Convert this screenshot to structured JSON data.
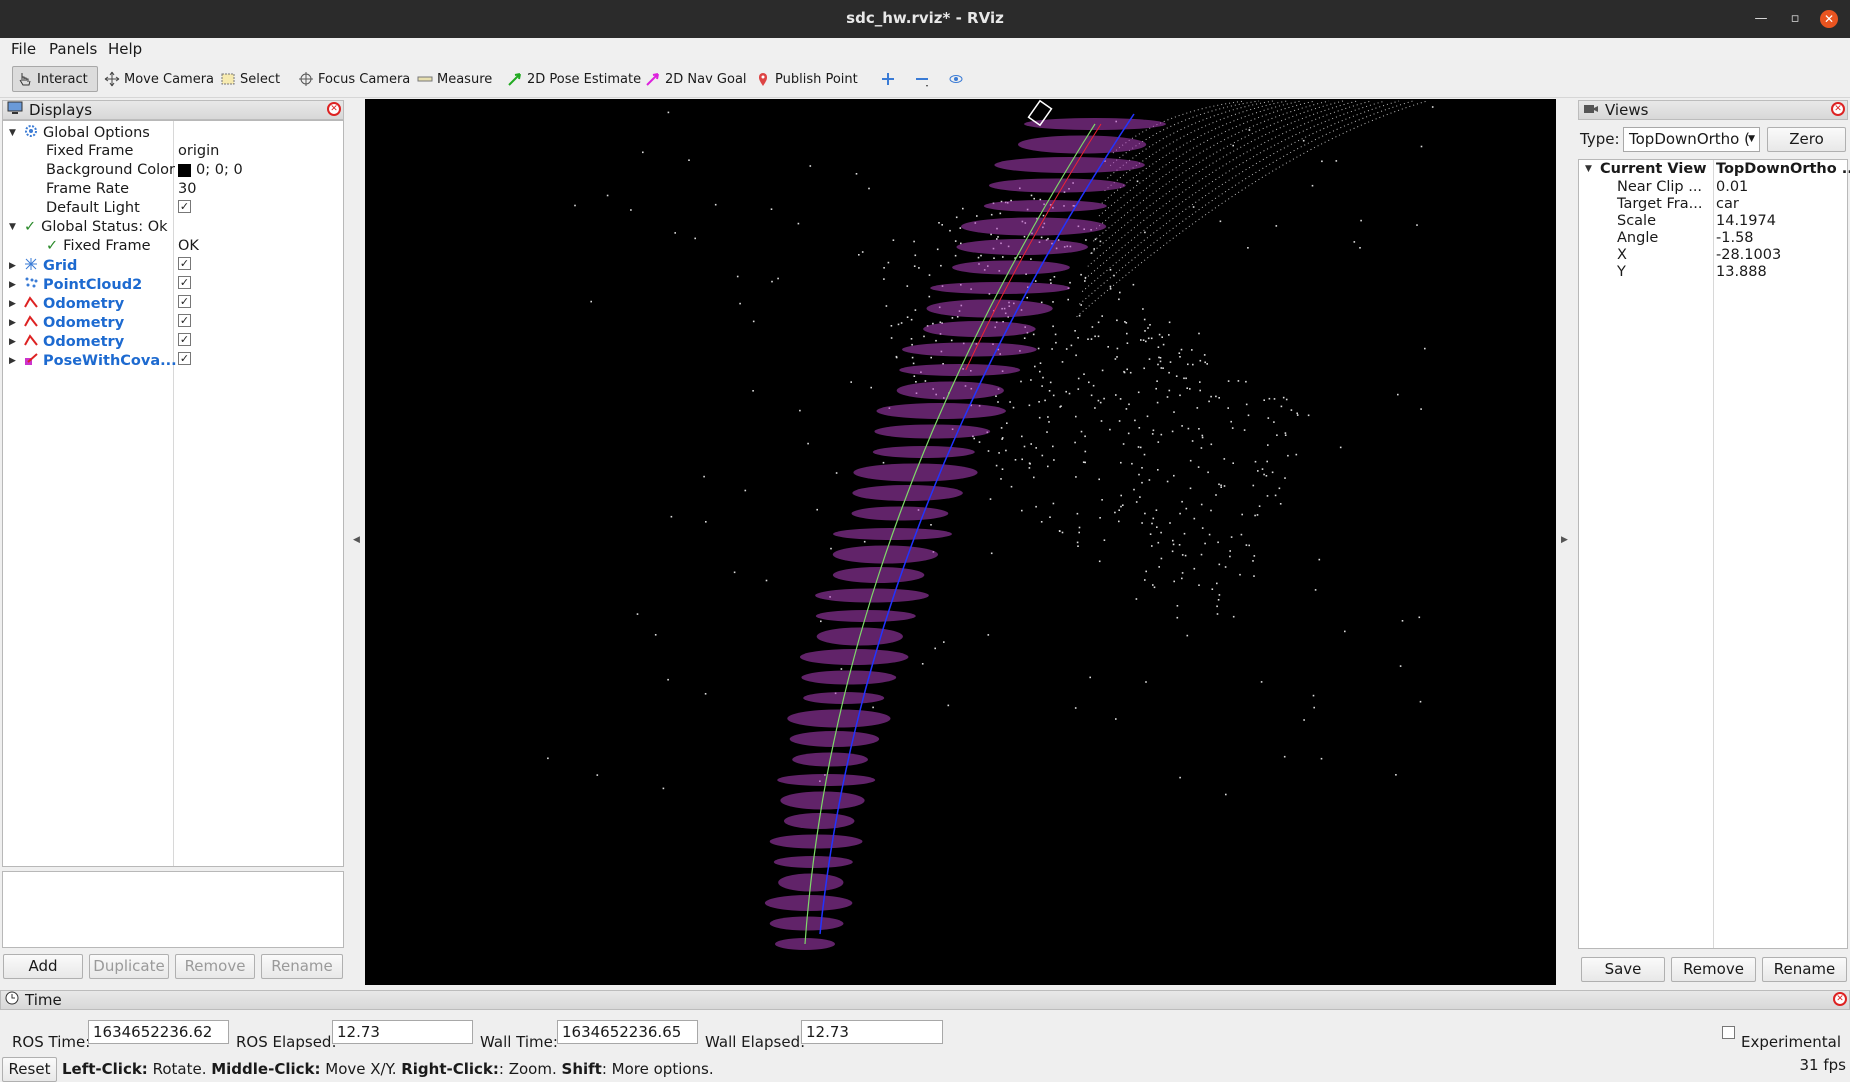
{
  "window": {
    "title": "sdc_hw.rviz* - RViz"
  },
  "menu": [
    "File",
    "Panels",
    "Help"
  ],
  "toolbar": {
    "interact": "Interact",
    "move_camera": "Move Camera",
    "select": "Select",
    "focus_camera": "Focus Camera",
    "measure": "Measure",
    "pose_estimate": "2D Pose Estimate",
    "nav_goal": "2D Nav Goal",
    "publish_point": "Publish Point"
  },
  "displays": {
    "title": "Displays",
    "global_options": "Global Options",
    "fixed_frame_label": "Fixed Frame",
    "fixed_frame_value": "origin",
    "background_color_label": "Background Color",
    "background_color_value": "0; 0; 0",
    "frame_rate_label": "Frame Rate",
    "frame_rate_value": "30",
    "default_light_label": "Default Light",
    "global_status": "Global Status: Ok",
    "status_fixed_frame": "Fixed Frame",
    "status_fixed_frame_value": "OK",
    "items": [
      {
        "label": "Grid",
        "icon": "grid-icon"
      },
      {
        "label": "PointCloud2",
        "icon": "pointcloud-icon"
      },
      {
        "label": "Odometry",
        "icon": "odometry-icon"
      },
      {
        "label": "Odometry",
        "icon": "odometry-icon"
      },
      {
        "label": "Odometry",
        "icon": "odometry-icon"
      },
      {
        "label": "PoseWithCova...",
        "icon": "pose-covariance-icon"
      }
    ],
    "buttons": {
      "add": "Add",
      "duplicate": "Duplicate",
      "remove": "Remove",
      "rename": "Rename"
    }
  },
  "views": {
    "title": "Views",
    "type_label": "Type:",
    "type_value": "TopDownOrtho (",
    "zero": "Zero",
    "current_view": "Current View",
    "current_view_value": "TopDownOrtho ...",
    "props": [
      {
        "label": "Near Clip ...",
        "value": "0.01"
      },
      {
        "label": "Target Fra...",
        "value": "car"
      },
      {
        "label": "Scale",
        "value": "14.1974"
      },
      {
        "label": "Angle",
        "value": "-1.58"
      },
      {
        "label": "X",
        "value": "-28.1003"
      },
      {
        "label": "Y",
        "value": "13.888"
      }
    ],
    "buttons": {
      "save": "Save",
      "remove": "Remove",
      "rename": "Rename"
    }
  },
  "time": {
    "title": "Time",
    "ros_time_label": "ROS Time:",
    "ros_time": "1634652236.62",
    "ros_elapsed_label": "ROS Elapsed:",
    "ros_elapsed": "12.73",
    "wall_time_label": "Wall Time:",
    "wall_time": "1634652236.65",
    "wall_elapsed_label": "Wall Elapsed:",
    "wall_elapsed": "12.73",
    "experimental": "Experimental"
  },
  "status": {
    "reset": "Reset",
    "left_click": "Left-Click:",
    "left_desc": " Rotate. ",
    "middle_click": "Middle-Click:",
    "middle_desc": " Move X/Y. ",
    "right_click": "Right-Click:",
    "right_desc": ": Zoom. ",
    "shift": "Shift",
    "shift_desc": ": More options.",
    "fps": "31 fps"
  },
  "colors": {
    "accent_blue": "#1d6ad0",
    "viewport_bg": "#000000",
    "ellipse": "#b040c0",
    "path_blue": "#2233ff"
  }
}
